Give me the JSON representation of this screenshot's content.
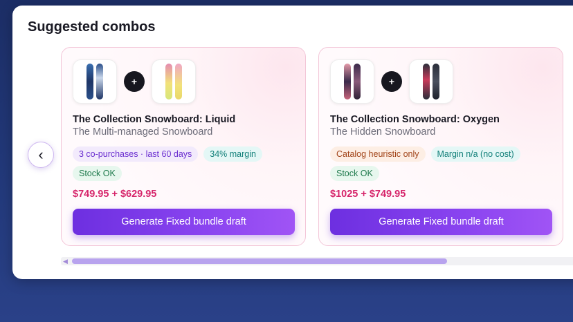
{
  "section": {
    "title": "Suggested combos",
    "prev_label": "‹"
  },
  "cards": [
    {
      "product1": {
        "image_icon": "snowboard-navy-icon",
        "colors": [
          "#2a4f8a",
          "#1e3566"
        ]
      },
      "product2": {
        "image_icon": "snowboard-yellow-pink-icon",
        "colors": [
          "#f2e27a",
          "#e58cb0"
        ]
      },
      "plus": "+",
      "title": "The Collection Snowboard: Liquid",
      "subtitle": "The Multi-managed Snowboard",
      "badges": [
        "3 co-purchases · last 60 days",
        "34% margin",
        "Stock OK"
      ],
      "price": "$749.95 + $629.95",
      "cta": "Generate Fixed bundle draft"
    },
    {
      "product1": {
        "image_icon": "snowboard-oxygen-icon",
        "colors": [
          "#3a2a4a",
          "#c7647a"
        ]
      },
      "product2": {
        "image_icon": "snowboard-dark-icon",
        "colors": [
          "#2a2e3a",
          "#c93a5a"
        ]
      },
      "plus": "+",
      "title": "The Collection Snowboard: Oxygen",
      "subtitle": "The Hidden Snowboard",
      "badges": [
        "Catalog heuristic only",
        "Margin n/a (no cost)",
        "Stock OK"
      ],
      "price": "$1025 + $749.95",
      "cta": "Generate Fixed bundle draft"
    }
  ],
  "colors": {
    "accent": "#7c3aed",
    "price": "#d6246a"
  }
}
